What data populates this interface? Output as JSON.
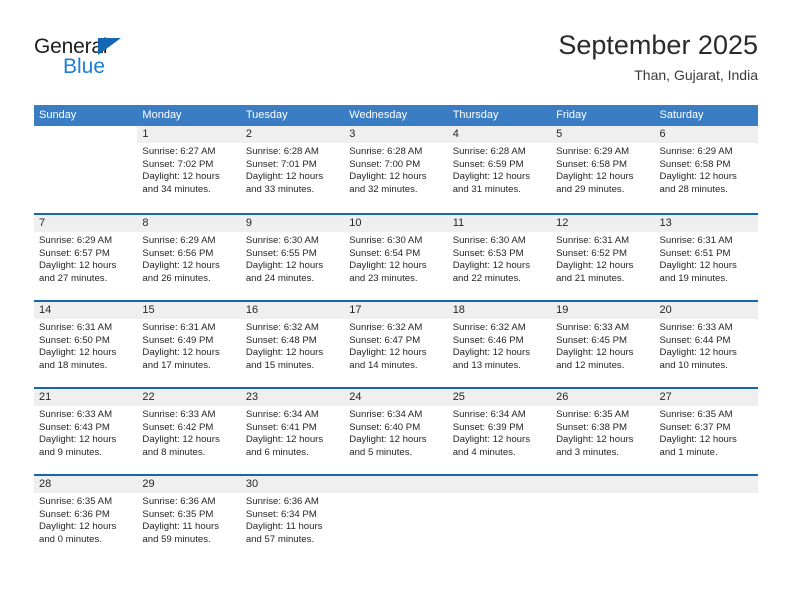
{
  "brand": {
    "name_top": "General",
    "name_bottom": "Blue",
    "triangle_icon": "triangle-icon",
    "color_dark": "#1d1d1d",
    "color_blue": "#1b7fd4"
  },
  "header": {
    "title": "September 2025",
    "subtitle": "Than, Gujarat, India"
  },
  "colors": {
    "header_blue": "#3b7dc4",
    "rule_blue": "#1667b1",
    "numband_gray": "#efefef",
    "text": "#262626"
  },
  "weekdays": [
    "Sunday",
    "Monday",
    "Tuesday",
    "Wednesday",
    "Thursday",
    "Friday",
    "Saturday"
  ],
  "weeks": [
    [
      {
        "day": ""
      },
      {
        "day": "1",
        "sunrise": "Sunrise: 6:27 AM",
        "sunset": "Sunset: 7:02 PM",
        "daylight": "Daylight: 12 hours and 34 minutes."
      },
      {
        "day": "2",
        "sunrise": "Sunrise: 6:28 AM",
        "sunset": "Sunset: 7:01 PM",
        "daylight": "Daylight: 12 hours and 33 minutes."
      },
      {
        "day": "3",
        "sunrise": "Sunrise: 6:28 AM",
        "sunset": "Sunset: 7:00 PM",
        "daylight": "Daylight: 12 hours and 32 minutes."
      },
      {
        "day": "4",
        "sunrise": "Sunrise: 6:28 AM",
        "sunset": "Sunset: 6:59 PM",
        "daylight": "Daylight: 12 hours and 31 minutes."
      },
      {
        "day": "5",
        "sunrise": "Sunrise: 6:29 AM",
        "sunset": "Sunset: 6:58 PM",
        "daylight": "Daylight: 12 hours and 29 minutes."
      },
      {
        "day": "6",
        "sunrise": "Sunrise: 6:29 AM",
        "sunset": "Sunset: 6:58 PM",
        "daylight": "Daylight: 12 hours and 28 minutes."
      }
    ],
    [
      {
        "day": "7",
        "sunrise": "Sunrise: 6:29 AM",
        "sunset": "Sunset: 6:57 PM",
        "daylight": "Daylight: 12 hours and 27 minutes."
      },
      {
        "day": "8",
        "sunrise": "Sunrise: 6:29 AM",
        "sunset": "Sunset: 6:56 PM",
        "daylight": "Daylight: 12 hours and 26 minutes."
      },
      {
        "day": "9",
        "sunrise": "Sunrise: 6:30 AM",
        "sunset": "Sunset: 6:55 PM",
        "daylight": "Daylight: 12 hours and 24 minutes."
      },
      {
        "day": "10",
        "sunrise": "Sunrise: 6:30 AM",
        "sunset": "Sunset: 6:54 PM",
        "daylight": "Daylight: 12 hours and 23 minutes."
      },
      {
        "day": "11",
        "sunrise": "Sunrise: 6:30 AM",
        "sunset": "Sunset: 6:53 PM",
        "daylight": "Daylight: 12 hours and 22 minutes."
      },
      {
        "day": "12",
        "sunrise": "Sunrise: 6:31 AM",
        "sunset": "Sunset: 6:52 PM",
        "daylight": "Daylight: 12 hours and 21 minutes."
      },
      {
        "day": "13",
        "sunrise": "Sunrise: 6:31 AM",
        "sunset": "Sunset: 6:51 PM",
        "daylight": "Daylight: 12 hours and 19 minutes."
      }
    ],
    [
      {
        "day": "14",
        "sunrise": "Sunrise: 6:31 AM",
        "sunset": "Sunset: 6:50 PM",
        "daylight": "Daylight: 12 hours and 18 minutes."
      },
      {
        "day": "15",
        "sunrise": "Sunrise: 6:31 AM",
        "sunset": "Sunset: 6:49 PM",
        "daylight": "Daylight: 12 hours and 17 minutes."
      },
      {
        "day": "16",
        "sunrise": "Sunrise: 6:32 AM",
        "sunset": "Sunset: 6:48 PM",
        "daylight": "Daylight: 12 hours and 15 minutes."
      },
      {
        "day": "17",
        "sunrise": "Sunrise: 6:32 AM",
        "sunset": "Sunset: 6:47 PM",
        "daylight": "Daylight: 12 hours and 14 minutes."
      },
      {
        "day": "18",
        "sunrise": "Sunrise: 6:32 AM",
        "sunset": "Sunset: 6:46 PM",
        "daylight": "Daylight: 12 hours and 13 minutes."
      },
      {
        "day": "19",
        "sunrise": "Sunrise: 6:33 AM",
        "sunset": "Sunset: 6:45 PM",
        "daylight": "Daylight: 12 hours and 12 minutes."
      },
      {
        "day": "20",
        "sunrise": "Sunrise: 6:33 AM",
        "sunset": "Sunset: 6:44 PM",
        "daylight": "Daylight: 12 hours and 10 minutes."
      }
    ],
    [
      {
        "day": "21",
        "sunrise": "Sunrise: 6:33 AM",
        "sunset": "Sunset: 6:43 PM",
        "daylight": "Daylight: 12 hours and 9 minutes."
      },
      {
        "day": "22",
        "sunrise": "Sunrise: 6:33 AM",
        "sunset": "Sunset: 6:42 PM",
        "daylight": "Daylight: 12 hours and 8 minutes."
      },
      {
        "day": "23",
        "sunrise": "Sunrise: 6:34 AM",
        "sunset": "Sunset: 6:41 PM",
        "daylight": "Daylight: 12 hours and 6 minutes."
      },
      {
        "day": "24",
        "sunrise": "Sunrise: 6:34 AM",
        "sunset": "Sunset: 6:40 PM",
        "daylight": "Daylight: 12 hours and 5 minutes."
      },
      {
        "day": "25",
        "sunrise": "Sunrise: 6:34 AM",
        "sunset": "Sunset: 6:39 PM",
        "daylight": "Daylight: 12 hours and 4 minutes."
      },
      {
        "day": "26",
        "sunrise": "Sunrise: 6:35 AM",
        "sunset": "Sunset: 6:38 PM",
        "daylight": "Daylight: 12 hours and 3 minutes."
      },
      {
        "day": "27",
        "sunrise": "Sunrise: 6:35 AM",
        "sunset": "Sunset: 6:37 PM",
        "daylight": "Daylight: 12 hours and 1 minute."
      }
    ],
    [
      {
        "day": "28",
        "sunrise": "Sunrise: 6:35 AM",
        "sunset": "Sunset: 6:36 PM",
        "daylight": "Daylight: 12 hours and 0 minutes."
      },
      {
        "day": "29",
        "sunrise": "Sunrise: 6:36 AM",
        "sunset": "Sunset: 6:35 PM",
        "daylight": "Daylight: 11 hours and 59 minutes."
      },
      {
        "day": "30",
        "sunrise": "Sunrise: 6:36 AM",
        "sunset": "Sunset: 6:34 PM",
        "daylight": "Daylight: 11 hours and 57 minutes."
      },
      {
        "day": ""
      },
      {
        "day": ""
      },
      {
        "day": ""
      },
      {
        "day": ""
      }
    ]
  ]
}
